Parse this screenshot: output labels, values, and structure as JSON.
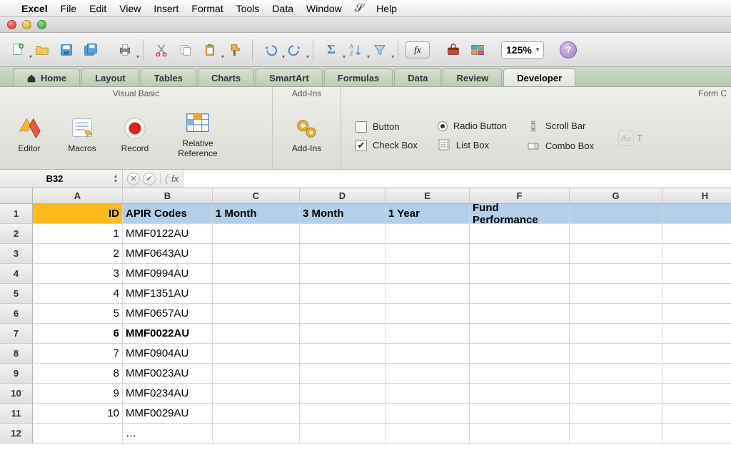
{
  "mac_menu": {
    "app": "Excel",
    "items": [
      "File",
      "Edit",
      "View",
      "Insert",
      "Format",
      "Tools",
      "Data",
      "Window"
    ],
    "help": "Help"
  },
  "toolbar": {
    "zoom": "125%"
  },
  "ribbon_tabs": [
    "Home",
    "Layout",
    "Tables",
    "Charts",
    "SmartArt",
    "Formulas",
    "Data",
    "Review",
    "Developer"
  ],
  "ribbon_active": "Developer",
  "ribbon": {
    "groups": {
      "visual_basic": {
        "title": "Visual Basic",
        "editor": "Editor",
        "macros": "Macros",
        "record": "Record",
        "relative_reference": "Relative Reference"
      },
      "addins": {
        "title": "Add-Ins",
        "button": "Add-Ins"
      },
      "form_controls": {
        "title_cut": "Form C",
        "button": "Button",
        "checkbox": "Check Box",
        "radio": "Radio Button",
        "listbox": "List Box",
        "scrollbar": "Scroll Bar",
        "combobox": "Combo Box",
        "t_label": "T"
      }
    }
  },
  "namebox": "B32",
  "formula": "",
  "columns": [
    "A",
    "B",
    "C",
    "D",
    "E",
    "F",
    "G",
    "H"
  ],
  "row_numbers": [
    "1",
    "2",
    "3",
    "4",
    "5",
    "6",
    "7",
    "8",
    "9",
    "10",
    "11",
    "12"
  ],
  "header_row": {
    "A": "ID",
    "B": "APIR Codes",
    "C": "1 Month",
    "D": "3 Month",
    "E": "1 Year",
    "F": "Fund Performance",
    "G": "",
    "H": ""
  },
  "data_rows": [
    {
      "id": "1",
      "code": "MMF0122AU",
      "bold": false
    },
    {
      "id": "2",
      "code": "MMF0643AU",
      "bold": false
    },
    {
      "id": "3",
      "code": "MMF0994AU",
      "bold": false
    },
    {
      "id": "4",
      "code": "MMF1351AU",
      "bold": false
    },
    {
      "id": "5",
      "code": "MMF0657AU",
      "bold": false
    },
    {
      "id": "6",
      "code": "MMF0022AU",
      "bold": true
    },
    {
      "id": "7",
      "code": "MMF0904AU",
      "bold": false
    },
    {
      "id": "8",
      "code": "MMF0023AU",
      "bold": false
    },
    {
      "id": "9",
      "code": "MMF0234AU",
      "bold": false
    },
    {
      "id": "10",
      "code": "MMF0029AU",
      "bold": false
    }
  ],
  "last_row_b": "…"
}
